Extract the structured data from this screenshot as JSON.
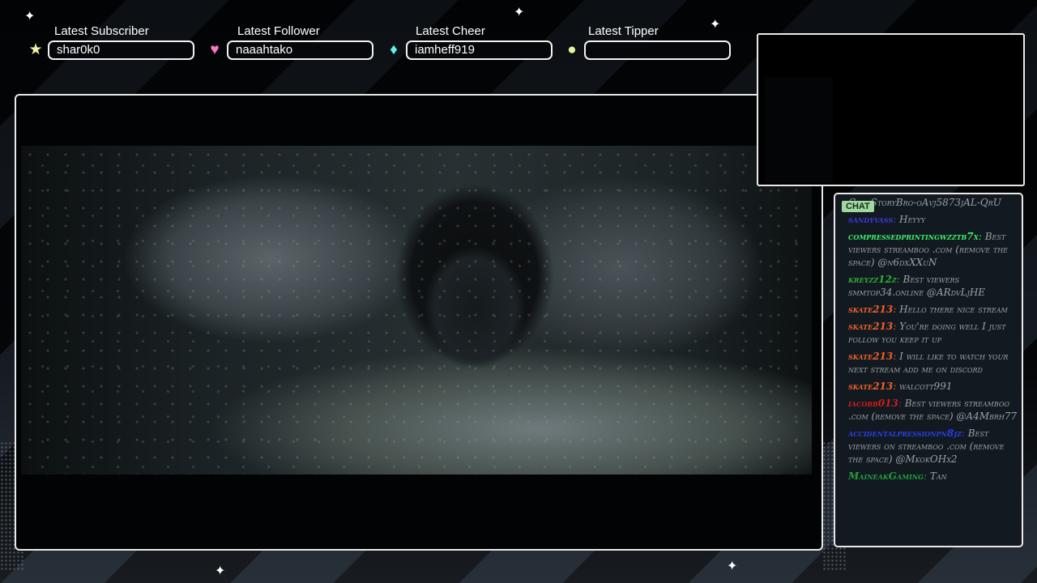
{
  "alerts": [
    {
      "title": "Latest Subscriber",
      "value": "shar0k0",
      "icon": "★",
      "icon_color": "#f4f1a6"
    },
    {
      "title": "Latest Follower",
      "value": "naaahtako",
      "icon": "♥",
      "icon_color": "#ff73c8"
    },
    {
      "title": "Latest Cheer",
      "value": "iamheff919",
      "icon": "♦",
      "icon_color": "#5ff0f0"
    },
    {
      "title": "Latest Tipper",
      "value": "",
      "icon": "●",
      "icon_color": "#e7f59a"
    }
  ],
  "chat": {
    "tab_label": "CHAT",
    "messages": [
      {
        "user": "",
        "user_color": "#9aa3a8",
        "text": "CoolStoryBro-oAvj5873jAL-QrU"
      },
      {
        "user": "sandyvass",
        "user_color": "#3a3adf",
        "text": "Heyyy"
      },
      {
        "user": "compressedprintingwzztb7x",
        "user_color": "#3df26a",
        "text": "Best viewers streamboo .com (remove the space) @n6dxXXuN"
      },
      {
        "user": "kreyzz12z",
        "user_color": "#2fae3a",
        "text": "Best viewers smmtop34.online @ARdvLjHE"
      },
      {
        "user": "skate213",
        "user_color": "#f0612a",
        "text": "Hello there nice stream"
      },
      {
        "user": "skate213",
        "user_color": "#f0612a",
        "text": "You're doing well I just follow you keep it up"
      },
      {
        "user": "skate213",
        "user_color": "#f0612a",
        "text": "I will like to watch your next stream add me on discord"
      },
      {
        "user": "skate213",
        "user_color": "#f0612a",
        "text": "walcott991"
      },
      {
        "user": "iacobb013",
        "user_color": "#d11c1c",
        "text": "Best viewers streamboo .com (remove the space) @A4Mbrh77"
      },
      {
        "user": "accidentalpressionpn8jz",
        "user_color": "#2a3fe8",
        "text": "Best viewers on streamboo .com (remove the space) @MkokOHx2"
      },
      {
        "user": "MaineakGaming",
        "user_color": "#1fa03a",
        "text": "Tan"
      }
    ]
  }
}
